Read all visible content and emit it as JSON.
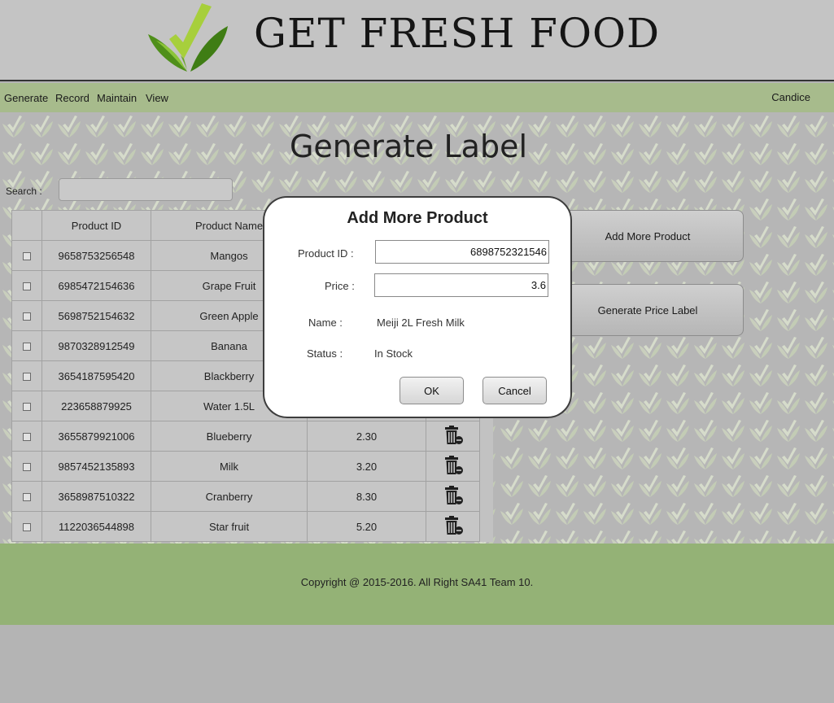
{
  "header": {
    "brand": "GET FRESH FOOD"
  },
  "nav": {
    "items": [
      "Generate",
      "Record",
      "Maintain",
      "View"
    ],
    "user": "Candice"
  },
  "page": {
    "title": "Generate Label",
    "search_label": "Search :",
    "search_value": ""
  },
  "table": {
    "headers": [
      "Product ID",
      "Product Name"
    ],
    "rows": [
      {
        "id": "9658753256548",
        "name": "Mangos",
        "price": ""
      },
      {
        "id": "6985472154636",
        "name": "Grape Fruit",
        "price": ""
      },
      {
        "id": "5698752154632",
        "name": "Green Apple",
        "price": ""
      },
      {
        "id": "9870328912549",
        "name": "Banana",
        "price": ""
      },
      {
        "id": "3654187595420",
        "name": "Blackberry",
        "price": ""
      },
      {
        "id": "223658879925",
        "name": "Water 1.5L",
        "price": ""
      },
      {
        "id": "3655879921006",
        "name": "Blueberry",
        "price": "2.30"
      },
      {
        "id": "9857452135893",
        "name": "Milk",
        "price": "3.20"
      },
      {
        "id": "3658987510322",
        "name": "Cranberry",
        "price": "8.30"
      },
      {
        "id": "1122036544898",
        "name": "Star fruit",
        "price": "5.20"
      }
    ]
  },
  "actions": {
    "add_more": "Add More Product",
    "generate_label": "Generate Price Label"
  },
  "footer": {
    "copyright": "Copyright @ 2015-2016. All Right SA41 Team 10."
  },
  "modal": {
    "title": "Add More Product",
    "product_id_label": "Product ID :",
    "product_id_value": "6898752321546",
    "price_label": "Price :",
    "price_value": "3.6",
    "name_label": "Name :",
    "name_value": "Meiji 2L Fresh Milk",
    "status_label": "Status :",
    "status_value": "In Stock",
    "ok": "OK",
    "cancel": "Cancel"
  },
  "colors": {
    "nav": "#a7bb8c",
    "footer": "#94b276",
    "logo_green": "#5d9a1c"
  }
}
